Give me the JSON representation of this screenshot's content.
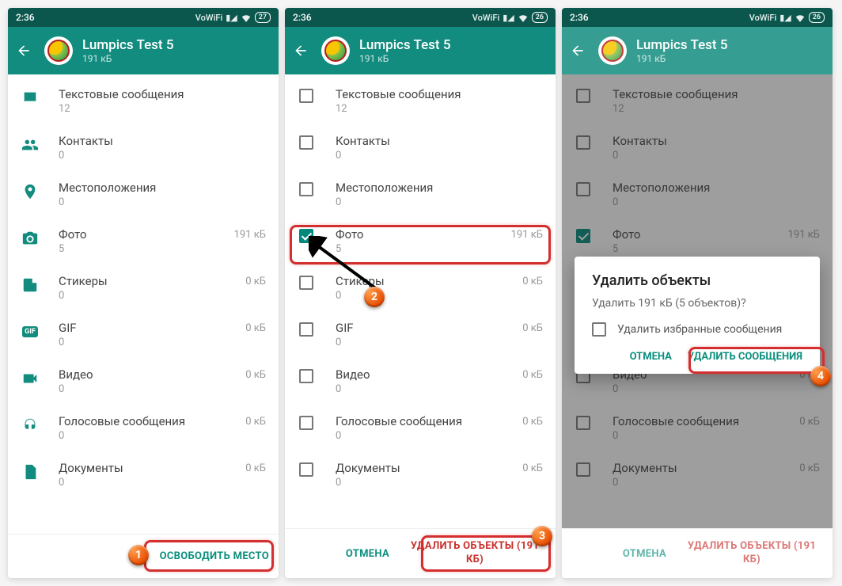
{
  "status": {
    "time": "2:36",
    "vowifi": "VoWiFi",
    "battery1": "27",
    "battery2": "26",
    "battery3": "26"
  },
  "header": {
    "title": "Lumpics Test 5",
    "sub": "191 кБ"
  },
  "items": {
    "text_msg": {
      "label": "Текстовые сообщения",
      "count": "12",
      "size": ""
    },
    "contacts": {
      "label": "Контакты",
      "count": "0",
      "size": ""
    },
    "location": {
      "label": "Местоположения",
      "count": "0",
      "size": ""
    },
    "photo": {
      "label": "Фото",
      "count": "5",
      "size": "191 кБ"
    },
    "stickers": {
      "label": "Стикеры",
      "count": "0",
      "size": "0 кБ"
    },
    "gif": {
      "label": "GIF",
      "count": "0",
      "size": "0 кБ"
    },
    "video": {
      "label": "Видео",
      "count": "0",
      "size": "0 кБ"
    },
    "voice": {
      "label": "Голосовые сообщения",
      "count": "0",
      "size": "0 кБ"
    },
    "docs": {
      "label": "Документы",
      "count": "0",
      "size": "0 кБ"
    }
  },
  "buttons": {
    "free_space": "ОСВОБОДИТЬ МЕСТО",
    "cancel": "ОТМЕНА",
    "delete_objects": "УДАЛИТЬ ОБЪЕКТЫ (191 КБ)"
  },
  "dialog": {
    "title": "Удалить объекты",
    "message": "Удалить 191 кБ (5 объектов)?",
    "option": "Удалить избранные сообщения",
    "cancel": "ОТМЕНА",
    "confirm": "УДАЛИТЬ СООБЩЕНИЯ"
  },
  "bubbles": {
    "b1": "1",
    "b2": "2",
    "b3": "3",
    "b4": "4"
  }
}
